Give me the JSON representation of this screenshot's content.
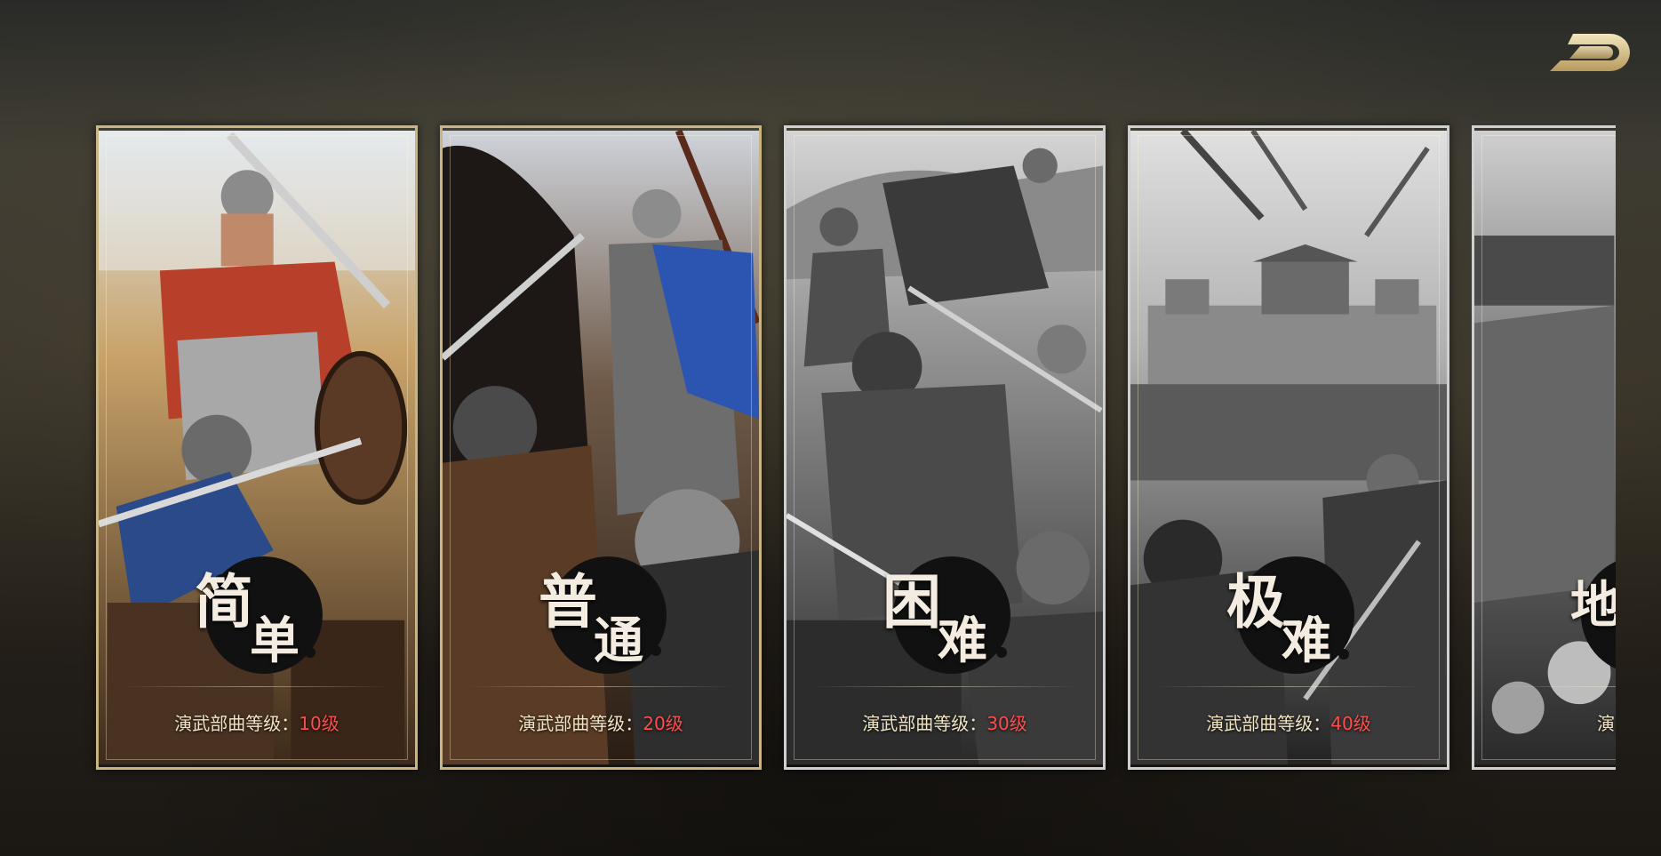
{
  "header": {
    "back_icon": "back-arrow-icon"
  },
  "cards": [
    {
      "badge_chars": [
        "简",
        "单"
      ],
      "req_label": "演武部曲等级：",
      "req_level": "10级",
      "locked": false
    },
    {
      "badge_chars": [
        "普",
        "通"
      ],
      "req_label": "演武部曲等级：",
      "req_level": "20级",
      "locked": false
    },
    {
      "badge_chars": [
        "困",
        "难"
      ],
      "req_label": "演武部曲等级：",
      "req_level": "30级",
      "locked": true
    },
    {
      "badge_chars": [
        "极",
        "难"
      ],
      "req_label": "演武部曲等级：",
      "req_level": "40级",
      "locked": true
    },
    {
      "badge_chars": [
        "地",
        ""
      ],
      "req_label": "演武部曲",
      "req_level": "",
      "locked": true
    }
  ],
  "colors": {
    "accent_gold": "#c9b583",
    "level_red": "#ff4d4d",
    "label_cream": "#f1e4c4"
  }
}
